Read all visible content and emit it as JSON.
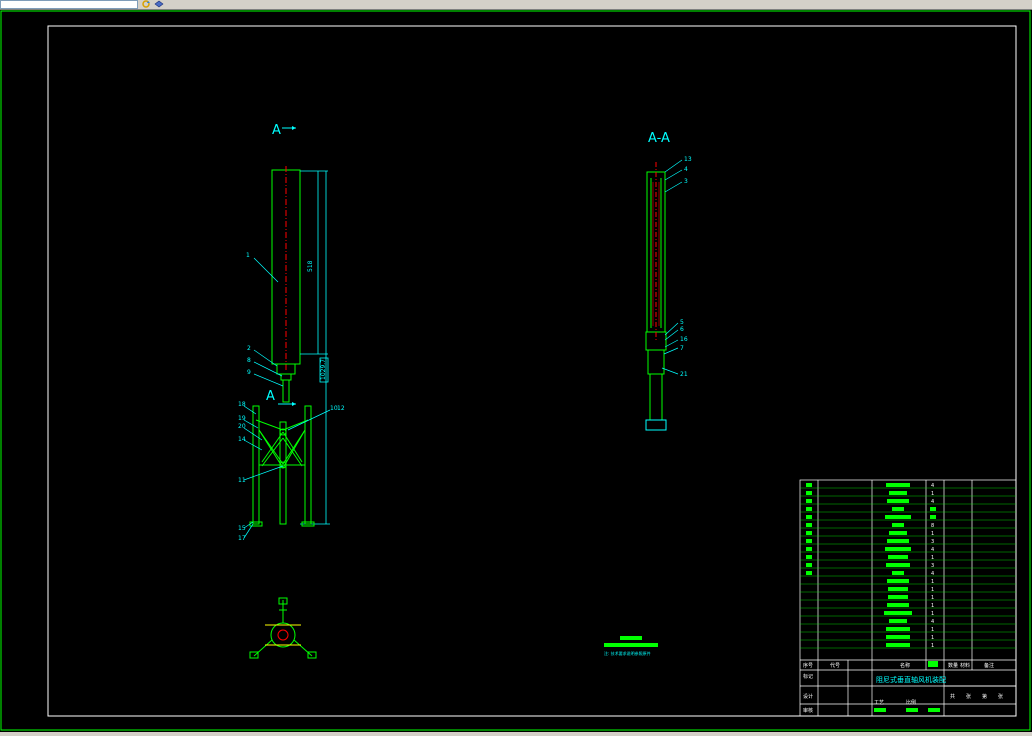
{
  "toolbar": {
    "field_value": "",
    "icons": [
      "refresh-icon",
      "layer-icon"
    ]
  },
  "drawing": {
    "view_marker_top": "A",
    "view_marker_bottom": "A",
    "section_title": "A-A",
    "dim_height": "518",
    "dim_total": "1029.7",
    "left_balloons": [
      "1",
      "2",
      "8",
      "9",
      "18",
      "19",
      "20",
      "14",
      "10",
      "12",
      "11",
      "15",
      "17"
    ],
    "right_balloons": [
      "13",
      "4",
      "3",
      "5",
      "6",
      "16",
      "7",
      "21"
    ],
    "note_text": "注: 技术要求说明参照原件",
    "colors": {
      "outline": "#00ff00",
      "leader": "#00ffff",
      "centerline": "#ff0000",
      "frame": "#ffffff",
      "background": "#000000"
    }
  },
  "title_block": {
    "title": "阻尼式垂直轴风机装配",
    "header_cols": [
      "序号",
      "代号",
      "名称",
      "数量",
      "材料",
      "备注"
    ],
    "rows_count_values": [
      "4",
      "1",
      "4",
      "1",
      "1",
      "8",
      "1",
      "3",
      "4",
      "1",
      "3",
      "4",
      "1",
      "1",
      "1",
      "1",
      "1",
      "4",
      "1",
      "1",
      "1"
    ],
    "sign_labels": [
      "设计",
      "审核",
      "工艺",
      "比例"
    ],
    "scale_cells": [
      "共",
      "张",
      "第",
      "张"
    ],
    "mid_labels": [
      "标记",
      "处数"
    ]
  }
}
